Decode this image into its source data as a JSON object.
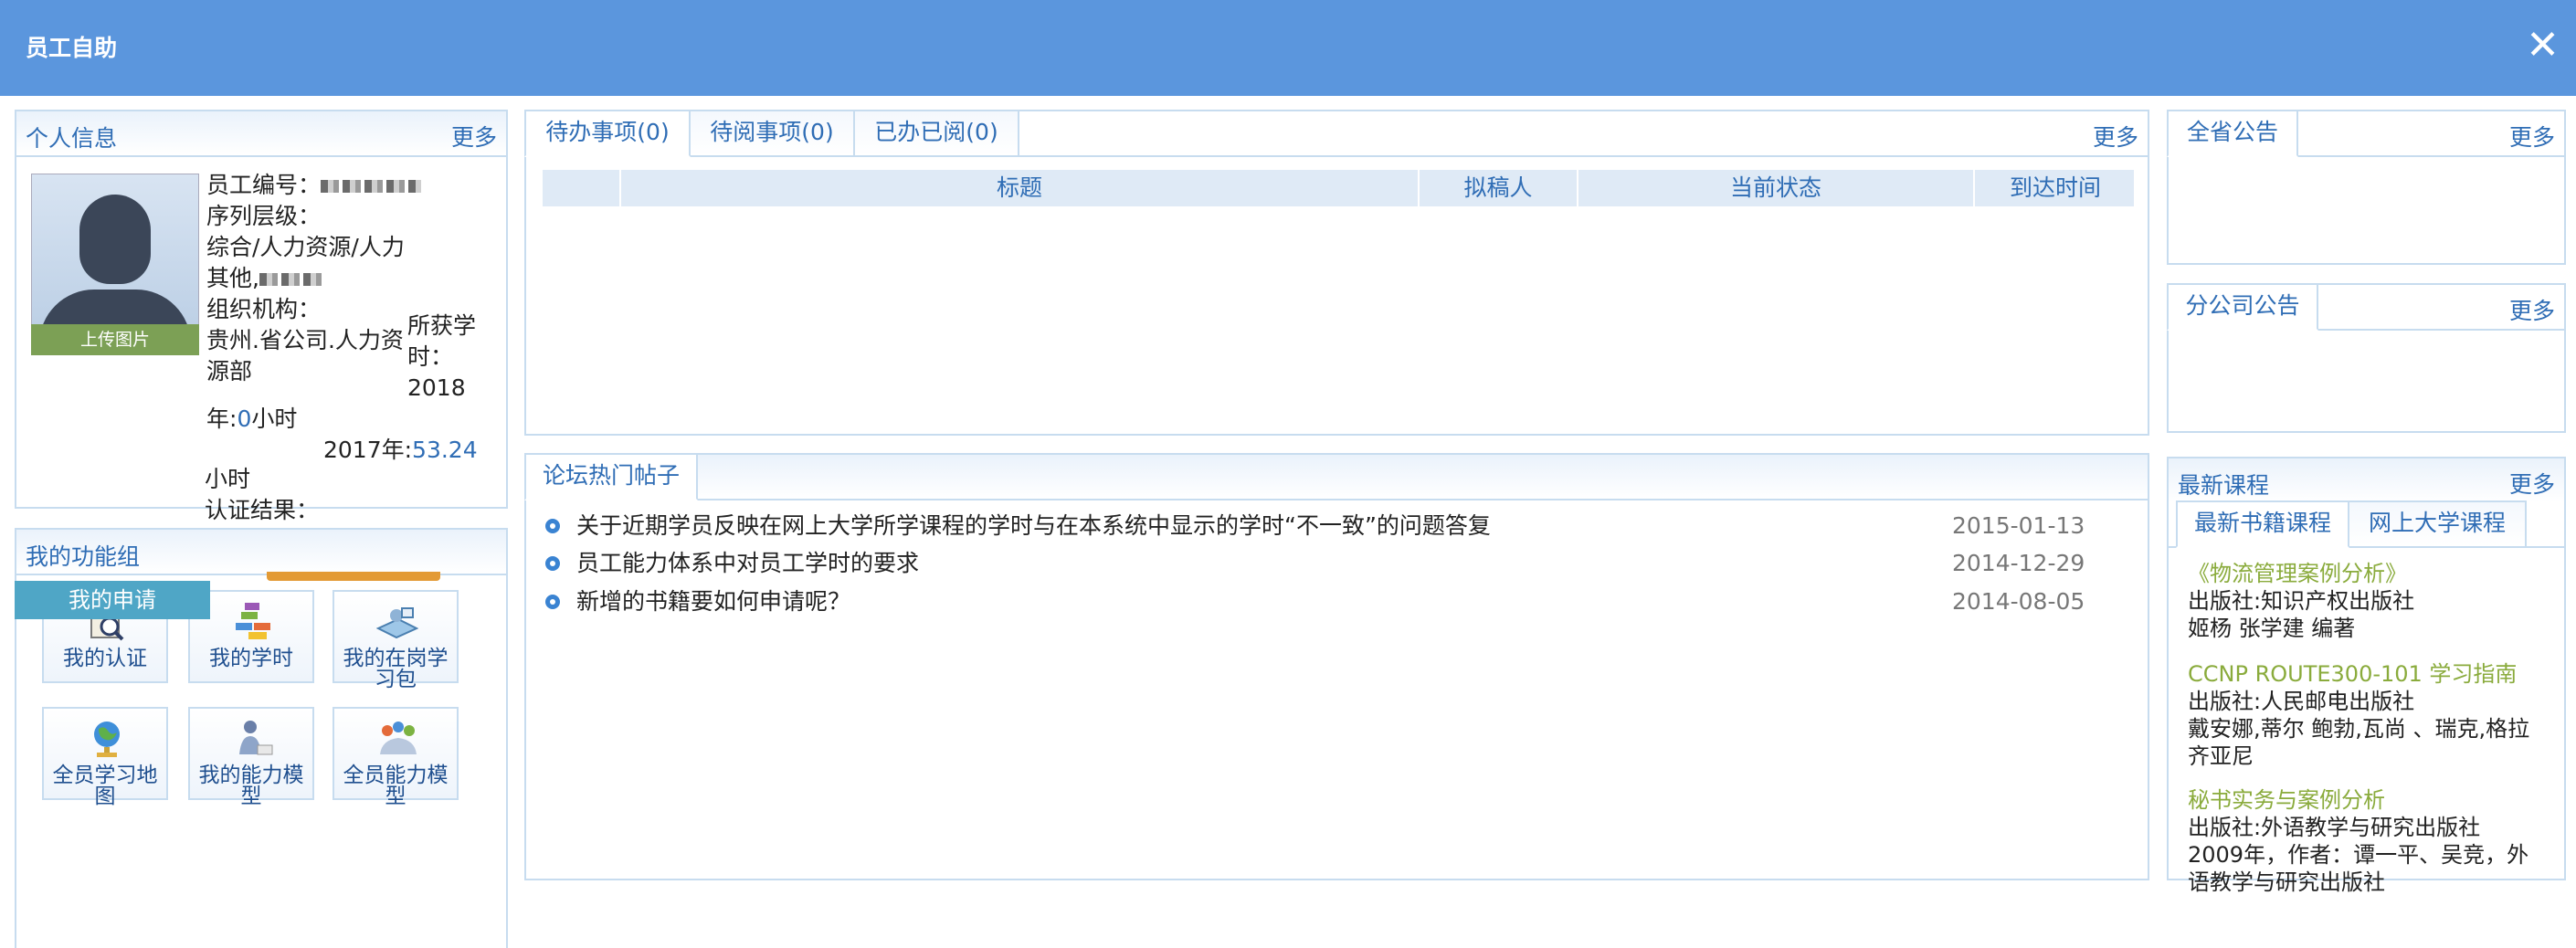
{
  "window": {
    "title": "员工自助",
    "close_icon": "close-icon"
  },
  "personal": {
    "title": "个人信息",
    "more": "更多",
    "upload_label": "上传图片",
    "employee_no_label": "员工编号：",
    "sequence_label": "序列层级：",
    "sequence_value_line1": "综合/人力资源/人力",
    "sequence_value_line2": "其他,",
    "org_label": "组织机构：",
    "org_value_line1": "贵州.省公司.人力资",
    "org_value_line2": "源部",
    "hours_label_1": "所获学",
    "hours_label_2": "时：",
    "hours_year_1": "2018",
    "year_suffix": "年:",
    "hours_2018_value": "0",
    "hours_unit": "小时",
    "hours_2017_label": "2017年:",
    "hours_2017_value": "53.24",
    "hours_unit_2": "小时",
    "cert_result_label": "认证结果："
  },
  "functions": {
    "title": "我的功能组",
    "apply_badge": "我的申请",
    "buttons": [
      {
        "label": "我的认证",
        "icon": "certificate-icon"
      },
      {
        "label": "我的学时",
        "icon": "books-icon"
      },
      {
        "label": "我的在岗学",
        "label2": "习包",
        "icon": "learning-package-icon"
      },
      {
        "label": "全员学习地",
        "label2": "图",
        "icon": "globe-icon"
      },
      {
        "label": "我的能力模",
        "label2": "型",
        "icon": "person-model-icon"
      },
      {
        "label": "全员能力模",
        "label2": "型",
        "icon": "group-model-icon"
      }
    ]
  },
  "tasks": {
    "tabs": [
      "待办事项(0)",
      "待阅事项(0)",
      "已办已阅(0)"
    ],
    "more": "更多",
    "columns": [
      "标题",
      "拟稿人",
      "当前状态",
      "到达时间"
    ]
  },
  "forum": {
    "title": "论坛热门帖子",
    "posts": [
      {
        "title": "关于近期学员反映在网上大学所学课程的学时与在本系统中显示的学时“不一致”的问题答复",
        "date": "2015-01-13"
      },
      {
        "title": "员工能力体系中对员工学时的要求",
        "date": "2014-12-29"
      },
      {
        "title": "新增的书籍要如何申请呢？",
        "date": "2014-08-05"
      }
    ]
  },
  "province_notice": {
    "title": "全省公告",
    "more": "更多"
  },
  "branch_notice": {
    "title": "分公司公告",
    "more": "更多"
  },
  "courses": {
    "title": "最新课程",
    "more": "更多",
    "tabs": [
      "最新书籍课程",
      "网上大学课程"
    ],
    "items": [
      {
        "title": "《物流管理案例分析》",
        "line1": "出版社:知识产权出版社",
        "line2": "姬杨 张学建 编著",
        "line3": ""
      },
      {
        "title": "CCNP ROUTE300-101 学习指南",
        "line1": "出版社:人民邮电出版社",
        "line2": "戴安娜,蒂尔 鲍勃,瓦尚 、瑞克,格拉",
        "line3": "齐亚尼"
      },
      {
        "title": "秘书实务与案例分析",
        "line1": "出版社:外语教学与研究出版社",
        "line2": "2009年，作者：谭一平、吴竞，外",
        "line3": "语教学与研究出版社"
      }
    ]
  }
}
